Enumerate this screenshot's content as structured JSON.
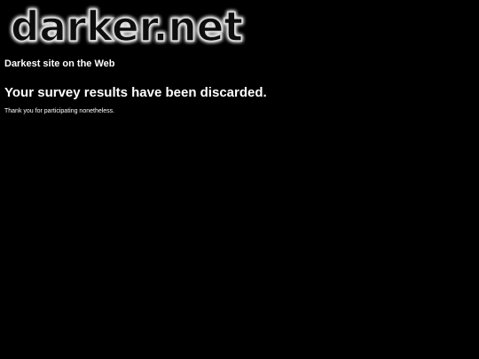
{
  "site": {
    "logo_text": "darker.net",
    "tagline": "Darkest site on the Web"
  },
  "main": {
    "headline": "Your survey results have been discarded.",
    "message": "Thank you for participating nonetheless."
  },
  "colors": {
    "background": "#000000",
    "text": "#ffffff",
    "logo_glow": "#ffffff"
  }
}
